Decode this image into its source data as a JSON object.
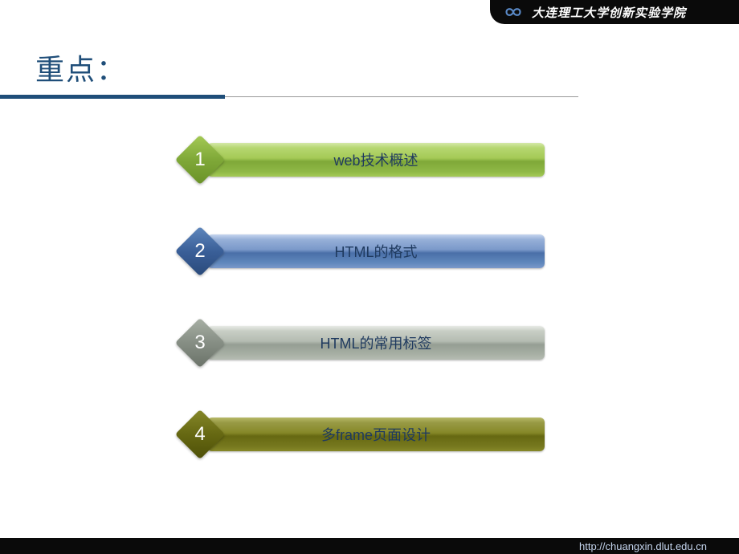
{
  "header": {
    "org_name": "大连理工大学创新实验学院",
    "logo": "infinity-icon"
  },
  "title": "重点：",
  "items": [
    {
      "number": "1",
      "label": "web技术概述"
    },
    {
      "number": "2",
      "label": "HTML的格式"
    },
    {
      "number": "3",
      "label": "HTML的常用标签"
    },
    {
      "number": "4",
      "label": "多frame页面设计"
    }
  ],
  "footer": {
    "url": "http://chuangxin.dlut.edu.cn"
  },
  "colors": {
    "title": "#1f4e79",
    "item1": "#7fa838",
    "item2": "#4a6fa8",
    "item3": "#959e93",
    "item4": "#666812"
  }
}
